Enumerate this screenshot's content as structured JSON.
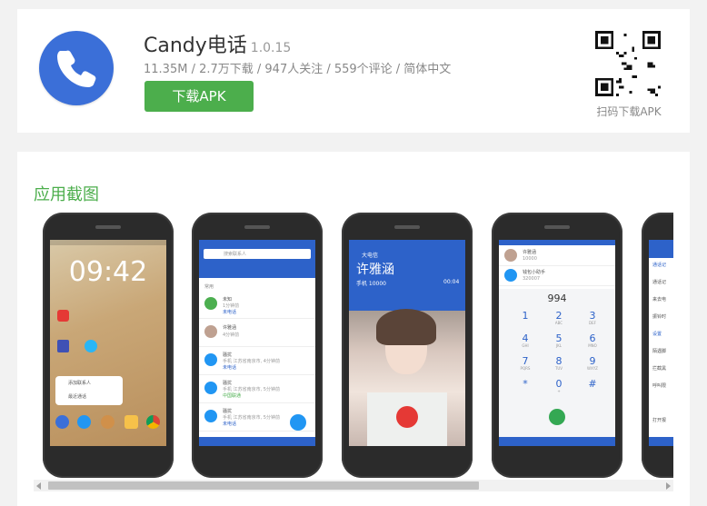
{
  "app": {
    "name": "Candy电话",
    "version": "1.0.15",
    "meta": "11.35M / 2.7万下载 / 947人关注 / 559个评论 / 简体中文",
    "download_label": "下载APK",
    "qr_label": "扫码下载APK",
    "icon": "phone-icon",
    "accent_color": "#4cae4c",
    "icon_color": "#3b6fd8"
  },
  "screenshots": {
    "section_title": "应用截图",
    "shot1": {
      "clock": "09:42",
      "apps": [
        "添加联系人",
        "最近通话"
      ]
    },
    "shot2": {
      "search_placeholder": "搜索联系人",
      "section": "常用",
      "contacts": [
        {
          "name": "未知",
          "sub": "1分钟前",
          "tag": "未电话"
        },
        {
          "name": "许雅涵",
          "sub": "4分钟前"
        },
        {
          "name": "骚扰",
          "sub": "手机 江苏省南京市, 4分钟前",
          "tag": "未电话"
        },
        {
          "name": "骚扰",
          "sub": "手机 江苏省南京市, 5分钟前",
          "tag": "中国联通"
        },
        {
          "name": "骚扰",
          "sub": "手机 江苏省南京市, 5分钟前",
          "tag": "未电话"
        }
      ]
    },
    "shot3": {
      "carrier": "大电信",
      "caller": "许雅涵",
      "number": "手机 10000",
      "duration": "00:04"
    },
    "shot4": {
      "contacts": [
        {
          "name": "许雅涵",
          "number": "10000"
        },
        {
          "name": "钱包小助手",
          "number": "320007"
        }
      ],
      "dialed": "994",
      "keys": [
        {
          "d": "1",
          "l": ""
        },
        {
          "d": "2",
          "l": "ABC"
        },
        {
          "d": "3",
          "l": "DEF"
        },
        {
          "d": "4",
          "l": "GHI"
        },
        {
          "d": "5",
          "l": "JKL"
        },
        {
          "d": "6",
          "l": "MNO"
        },
        {
          "d": "7",
          "l": "PQRS"
        },
        {
          "d": "8",
          "l": "TUV"
        },
        {
          "d": "9",
          "l": "WXYZ"
        },
        {
          "d": "*",
          "l": ""
        },
        {
          "d": "0",
          "l": "+"
        },
        {
          "d": "#",
          "l": ""
        }
      ]
    },
    "shot5": {
      "items": [
        "通话记",
        "通话记",
        "来去电",
        "振铃时",
        "设置",
        "陌遇脚",
        "拦截黑",
        "呼叫限",
        "",
        "打开报"
      ]
    }
  }
}
